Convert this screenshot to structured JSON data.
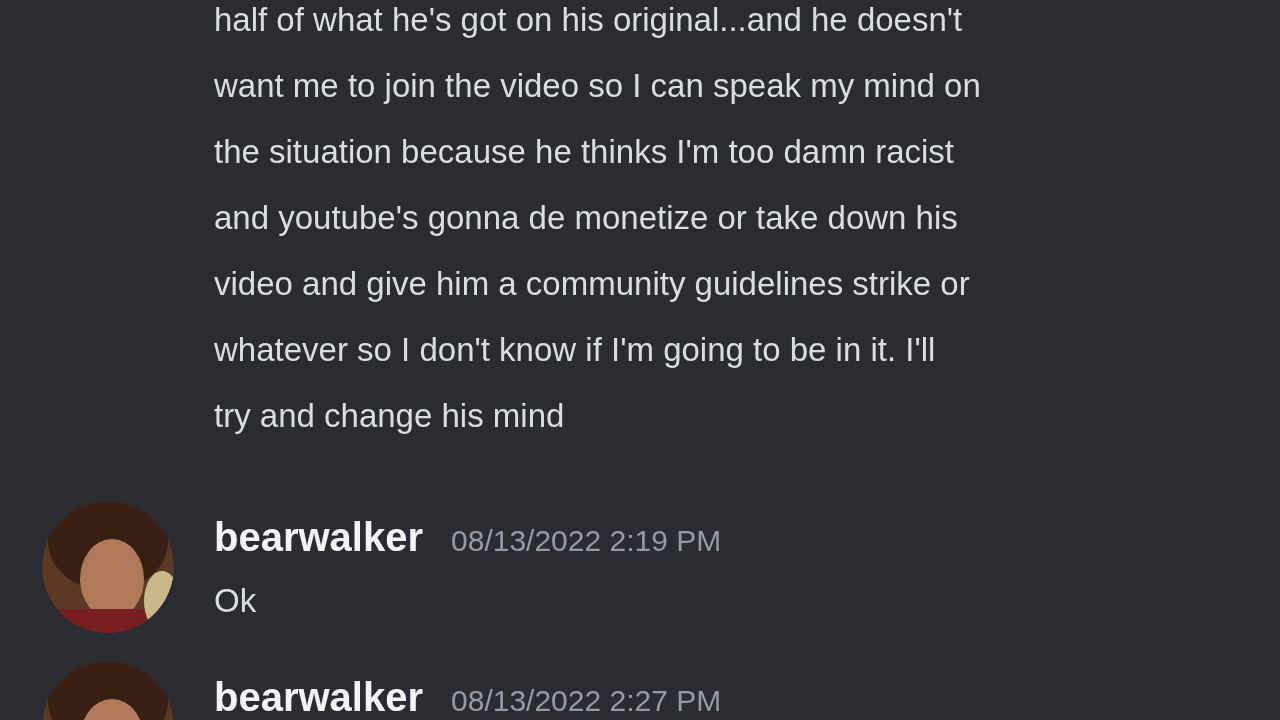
{
  "messages": [
    {
      "kind": "continuation",
      "lines": [
        "half of what he's got on his original...and he doesn't",
        "want me to join the video so I can speak my mind on",
        "the situation because he thinks I'm too damn racist",
        "and youtube's gonna de monetize or take down his",
        "video and give him a community guidelines strike or",
        "whatever so I don't know if I'm going to be in it. I'll",
        "try and change his mind"
      ]
    },
    {
      "kind": "message",
      "author": "bearwalker",
      "timestamp": "08/13/2022 2:19 PM",
      "lines": [
        "Ok"
      ]
    },
    {
      "kind": "message",
      "author": "bearwalker",
      "timestamp": "08/13/2022 2:27 PM"
    }
  ]
}
